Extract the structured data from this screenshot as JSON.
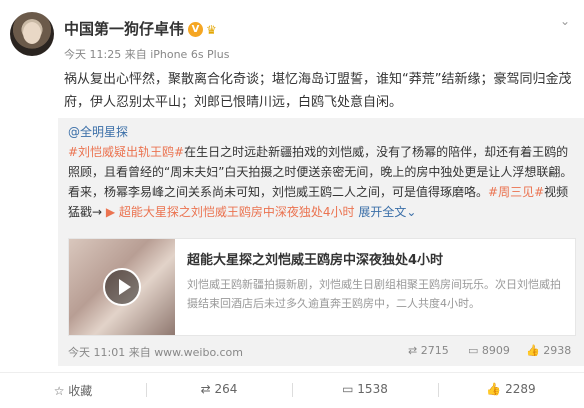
{
  "header": {
    "username": "中国第一狗仔卓伟",
    "verified_badge": "V",
    "crown": "♛",
    "meta": "今天 11:25 来自 iPhone 6s Plus",
    "dropdown": "⌄"
  },
  "post": {
    "text": "祸从复出心怦然，聚散离合化奇谈；堪忆海岛订盟誓，谁知“莽荒”结新缘；豪驾同归金茂府，伊人忍别太平山；刘郎已恨晴川远，白鸥飞处意自闲。"
  },
  "repost": {
    "author": "@全明星探",
    "tag1": "#刘恺威疑出轨王鸥#",
    "text1": "在生日之时远赴新疆拍戏的刘恺威，没有了杨幂的陪伴，却还有着王鸥的照顾，且看曾经的“周末夫妇”白天拍摄之时便送亲密无间，晚上的房中独处更是让人浮想联翩。看来，杨幂李易峰之间关系尚未可知，刘恺威王鸥二人之间，可是值得琢磨咯。",
    "tag2": "#周三见#",
    "text2": "视频猛戳→",
    "video_link": "超能大星探之刘恺威王鸥房中深夜独处4小时",
    "expand": "展开全文",
    "card": {
      "title": "超能大星探之刘恺威王鸥房中深夜独处4小时",
      "desc": "刘恺威王鸥新疆拍摄新剧，刘恺威生日剧组相聚王鸥房间玩乐。次日刘恺威拍摄结束回酒店后未过多久逾直奔王鸥房中，二人共度4小时。"
    },
    "footer": {
      "time": "今天 11:01 来自 www.weibo.com",
      "reposts": "2715",
      "comments": "8909",
      "likes": "2938"
    }
  },
  "actions": {
    "favorite": "收藏",
    "repost": "264",
    "comment": "1538",
    "like": "2289"
  }
}
